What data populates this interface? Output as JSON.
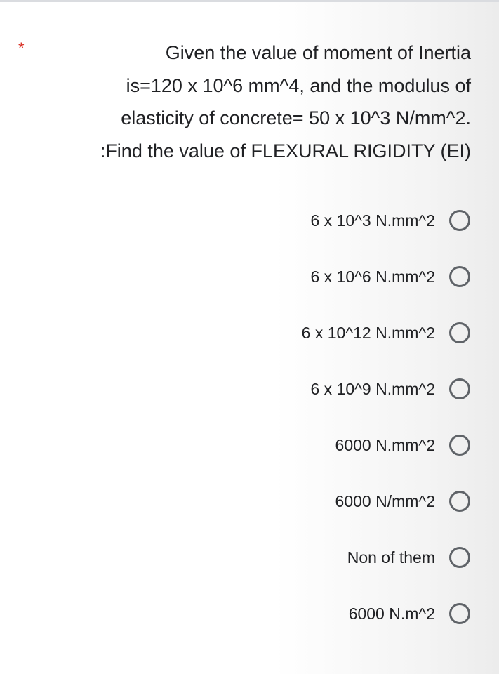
{
  "question": {
    "required_marker": "*",
    "lines": [
      "Given the value of moment of Inertia",
      "is=120 x 10^6 mm^4, and the modulus of",
      "elasticity of concrete= 50 x 10^3 N/mm^2.",
      ":Find the value of FLEXURAL RIGIDITY (EI)"
    ]
  },
  "options": [
    {
      "label": "6 x 10^3 N.mm^2",
      "selected": false
    },
    {
      "label": "6 x 10^6 N.mm^2",
      "selected": false
    },
    {
      "label": "6 x 10^12 N.mm^2",
      "selected": false
    },
    {
      "label": "6 x 10^9 N.mm^2",
      "selected": false
    },
    {
      "label": "6000 N.mm^2",
      "selected": false
    },
    {
      "label": "6000 N/mm^2",
      "selected": false
    },
    {
      "label": "Non of them",
      "selected": false
    },
    {
      "label": "6000 N.m^2",
      "selected": false
    }
  ],
  "colors": {
    "required": "#d93025",
    "radio_border": "#5f6368",
    "text": "#202124"
  }
}
